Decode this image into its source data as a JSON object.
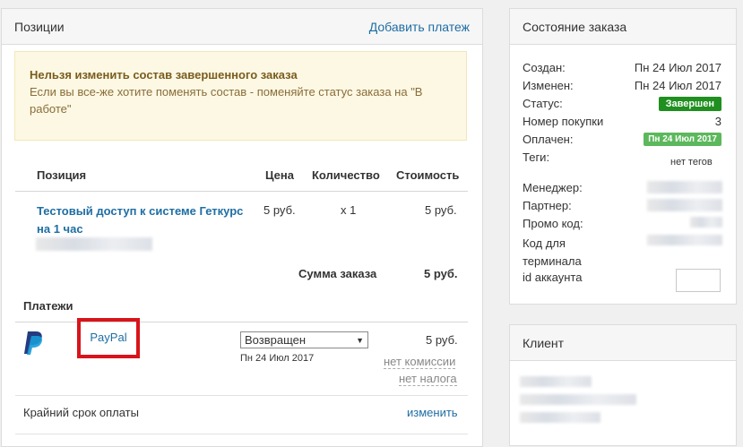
{
  "positions_panel": {
    "title": "Позиции",
    "add_payment": "Добавить платеж",
    "warning_title": "Нельзя изменить состав завершенного заказа",
    "warning_text": "Если вы все-же хотите поменять состав - поменяйте статус заказа на \"В работе\"",
    "table": {
      "headers": [
        "Позиция",
        "Цена",
        "Количество",
        "Стоимость"
      ],
      "rows": [
        {
          "name": "Тестовый доступ к системе Геткурс на 1 час",
          "price": "5 руб.",
          "qty": "x 1",
          "cost": "5 руб."
        }
      ],
      "sum_label": "Сумма заказа",
      "sum_value": "5 руб."
    },
    "payments": {
      "title": "Платежи",
      "method": "PayPal",
      "status": "Возвращен",
      "date": "Пн 24 Июл 2017",
      "amount": "5 руб.",
      "commission": "нет комиссии",
      "tax": "нет налога",
      "icon": "paypal-icon"
    },
    "deadline_label": "Крайний срок оплаты",
    "deadline_action": "изменить"
  },
  "state_panel": {
    "title": "Состояние заказа",
    "created_label": "Создан:",
    "created_value": "Пн 24 Июл 2017",
    "changed_label": "Изменен:",
    "changed_value": "Пн 24 Июл 2017",
    "status_label": "Статус:",
    "status_value": "Завершен",
    "purchase_label": "Номер покупки",
    "purchase_value": "3",
    "paid_label": "Оплачен:",
    "paid_value": "Пн 24 Июл 2017",
    "tags_label": "Теги:",
    "tags_value": "нет тегов",
    "manager_label": "Менеджер:",
    "partner_label": "Партнер:",
    "promo_label": "Промо код:",
    "terminal_label": "Код для терминала",
    "account_label": "id аккаунта",
    "colors": {
      "status": "#1f8f1f",
      "paid": "#5cb85c"
    }
  },
  "client_panel": {
    "title": "Клиент"
  }
}
